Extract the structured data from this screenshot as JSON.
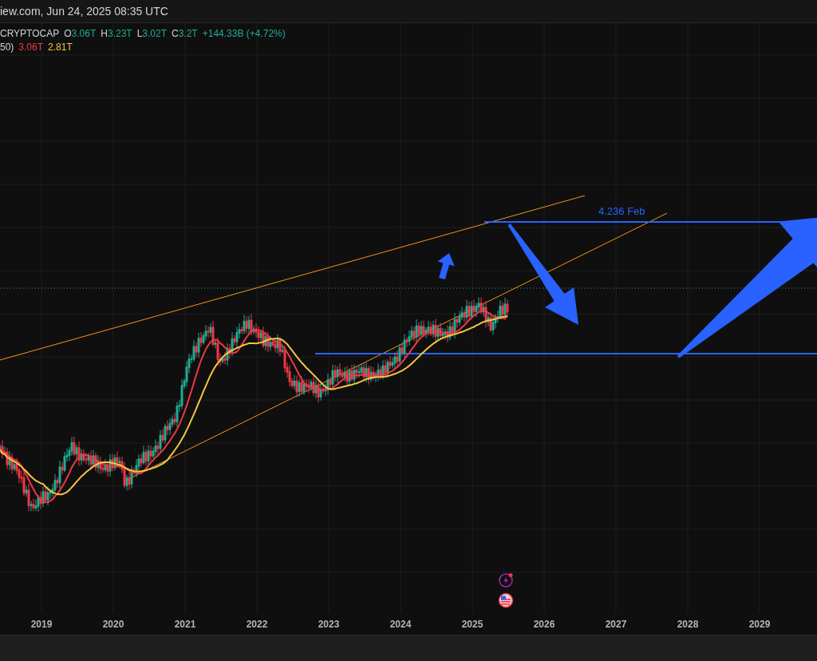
{
  "header": {
    "text": "iew.com, Jun 24, 2025 08:35 UTC"
  },
  "legend": {
    "symbol": "CRYPTOCAP",
    "fields": [
      {
        "label": "O",
        "value": "3.06T"
      },
      {
        "label": "H",
        "value": "3.23T"
      },
      {
        "label": "L",
        "value": "3.02T"
      },
      {
        "label": "C",
        "value": "3.2T"
      }
    ],
    "change": "+144.33B (+4.72%)"
  },
  "indicator": {
    "label": "50)",
    "values": [
      {
        "text": "3.06T",
        "color": "#f23645"
      },
      {
        "text": "2.81T",
        "color": "#f5c542"
      }
    ]
  },
  "chart": {
    "fib_label": "4.236 Feb"
  },
  "x_axis": {
    "labels": [
      "2019",
      "2020",
      "2021",
      "2022",
      "2023",
      "2024",
      "2025",
      "2026",
      "2027",
      "2028",
      "2029"
    ]
  }
}
